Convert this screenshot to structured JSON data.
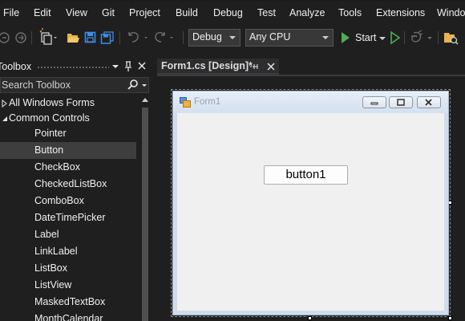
{
  "menu": {
    "items": [
      {
        "label": "File"
      },
      {
        "label": "Edit"
      },
      {
        "label": "View"
      },
      {
        "label": "Git"
      },
      {
        "label": "Project"
      },
      {
        "label": "Build"
      },
      {
        "label": "Debug"
      },
      {
        "label": "Test"
      },
      {
        "label": "Analyze"
      },
      {
        "label": "Tools"
      },
      {
        "label": "Extensions"
      },
      {
        "label": "Windo"
      }
    ]
  },
  "toolbar": {
    "configuration": "Debug",
    "platform": "Any CPU",
    "start_label": "Start",
    "icons": [
      "back-icon",
      "forward-icon",
      "new-item-icon",
      "open-folder-icon",
      "save-icon",
      "save-all-icon",
      "undo-icon",
      "redo-icon",
      "start-icon",
      "start-without-debugging-icon",
      "hot-reload-icon",
      "solution-explorer-icon"
    ]
  },
  "toolbox": {
    "title": "Toolbox",
    "search_placeholder": "Search Toolbox",
    "groups": [
      {
        "label": "All Windows Forms",
        "expanded": false
      },
      {
        "label": "Common Controls",
        "expanded": true
      }
    ],
    "items": [
      {
        "label": "Pointer"
      },
      {
        "label": "Button"
      },
      {
        "label": "CheckBox"
      },
      {
        "label": "CheckedListBox"
      },
      {
        "label": "ComboBox"
      },
      {
        "label": "DateTimePicker"
      },
      {
        "label": "Label"
      },
      {
        "label": "LinkLabel"
      },
      {
        "label": "ListBox"
      },
      {
        "label": "ListView"
      },
      {
        "label": "MaskedTextBox"
      },
      {
        "label": "MonthCalendar"
      }
    ],
    "selected_item": "Button"
  },
  "document_tab": {
    "title": "Form1.cs [Design]*"
  },
  "designer": {
    "form_title": "Form1",
    "button_text": "button1"
  },
  "colors": {
    "ide_background": "#1f1f1f",
    "start_green": "#4caf50",
    "save_blue": "#3d8ee6",
    "folder_yellow": "#e8b44a",
    "selected_row": "#3e3e3e",
    "form_client": "#f0f0f0"
  }
}
